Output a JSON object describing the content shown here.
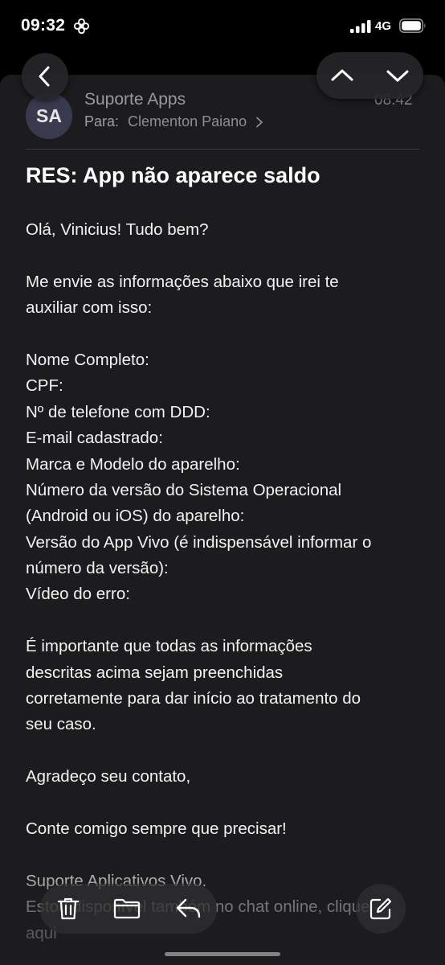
{
  "status_bar": {
    "time": "09:32",
    "network": "4G",
    "mode_icon": "focus-flower-icon",
    "signal_icon": "cellular-signal-icon",
    "battery_icon": "battery-icon"
  },
  "navigation": {
    "back_icon": "chevron-left-icon",
    "previous_icon": "chevron-up-icon",
    "next_icon": "chevron-down-icon"
  },
  "email": {
    "sender_initials": "SA",
    "sender_name": "Suporte Apps",
    "time": "08:42",
    "recipient_label": "Para:",
    "recipient_name": "Clementon Paiano",
    "subject": "RES: App não aparece saldo",
    "body_lines": [
      "Olá, Vinicius! Tudo bem?",
      "",
      "Me envie as informações abaixo que irei te",
      "auxiliar com isso:",
      "",
      "Nome Completo:",
      "CPF:",
      "Nº de telefone com DDD:",
      "E-mail cadastrado:",
      "Marca e Modelo do aparelho:",
      "Número da versão do Sistema Operacional",
      "(Android ou iOS) do aparelho:",
      "Versão do App Vivo (é indispensável informar o",
      "número da versão):",
      "Vídeo do erro:",
      "",
      "É importante que todas as informações",
      "descritas acima sejam preenchidas",
      "corretamente para dar início ao tratamento do",
      "seu caso.",
      "",
      "Agradeço seu contato,",
      "",
      "Conte comigo sempre que precisar!",
      "",
      "Suporte Aplicativos Vivo.",
      "Estou disponível também no chat online, clique",
      "aqui"
    ]
  },
  "toolbar": {
    "delete_icon": "trash-icon",
    "move_icon": "folder-icon",
    "reply_icon": "reply-icon",
    "compose_icon": "compose-icon"
  },
  "colors": {
    "background": "#000000",
    "sheet": "#1c1c1e",
    "avatar": "#3a3a4e",
    "secondary_text": "#8e8e93",
    "primary_text": "#f2f2f2"
  }
}
